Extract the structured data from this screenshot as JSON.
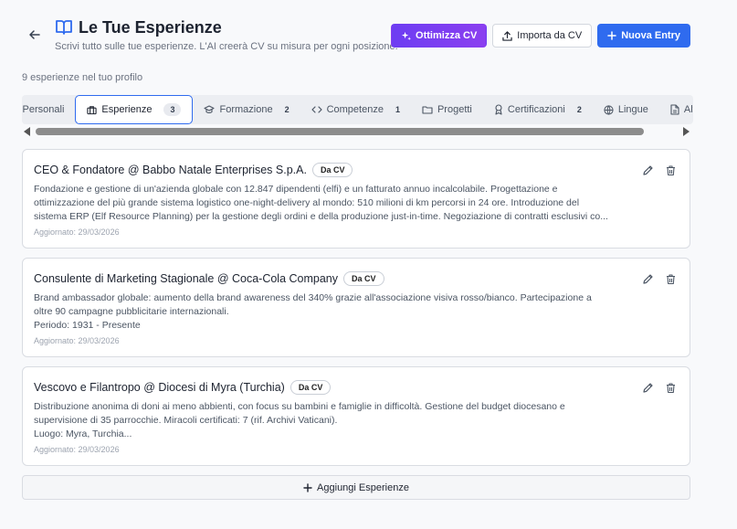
{
  "header": {
    "title": "Le Tue Esperienze",
    "subtitle": "Scrivi tutto sulle tue esperienze. L'AI creerà CV su misura per ogni posizione.",
    "optimize_label": "Ottimizza CV",
    "import_label": "Importa da CV",
    "new_label": "Nuova Entry"
  },
  "profile_count": "9 esperienze nel tuo profilo",
  "tabs": [
    {
      "label": "Dati Personali",
      "visible_label": "ti Personali",
      "badge": ""
    },
    {
      "label": "Esperienze",
      "badge": "3"
    },
    {
      "label": "Formazione",
      "badge": "2"
    },
    {
      "label": "Competenze",
      "badge": "1"
    },
    {
      "label": "Progetti",
      "badge": ""
    },
    {
      "label": "Certificazioni",
      "badge": "2"
    },
    {
      "label": "Lingue",
      "badge": ""
    },
    {
      "label": "Altro",
      "visible_label": "Altro",
      "badge": ""
    }
  ],
  "entries": [
    {
      "title": "CEO & Fondatore @ Babbo Natale Enterprises S.p.A.",
      "tag": "Da CV",
      "lines": [
        "Fondazione e gestione di un'azienda globale con 12.847 dipendenti (elfi) e un fatturato annuo incalcolabile. Progettazione e",
        "ottimizzazione del più grande sistema logistico one-night-delivery al mondo: 510 milioni di km percorsi in 24 ore. Introduzione del",
        "sistema ERP (Elf Resource Planning) per la gestione degli ordini e della produzione just-in-time. Negoziazione di contratti esclusivi co..."
      ],
      "date": "Aggiornato: 29/03/2026"
    },
    {
      "title": "Consulente di Marketing Stagionale @ Coca-Cola Company",
      "tag": "Da CV",
      "lines": [
        "Brand ambassador globale: aumento della brand awareness del 340% grazie all'associazione visiva rosso/bianco. Partecipazione a",
        "oltre 90 campagne pubblicitarie internazionali.",
        "Periodo: 1931 - Presente"
      ],
      "date": "Aggiornato: 29/03/2026"
    },
    {
      "title": "Vescovo e Filantropo @ Diocesi di Myra (Turchia)",
      "tag": "Da CV",
      "lines": [
        "Distribuzione anonima di doni ai meno abbienti, con focus su bambini e famiglie in difficoltà. Gestione del budget diocesano e",
        "supervisione di 35 parrocchie. Miracoli certificati: 7 (rif. Archivi Vaticani).",
        "Luogo: Myra, Turchia..."
      ],
      "date": "Aggiornato: 29/03/2026"
    }
  ],
  "add_label": "Aggiungi Esperienze",
  "colors": {
    "accent": "#2f6bef",
    "magic": "#7c3ef1"
  }
}
